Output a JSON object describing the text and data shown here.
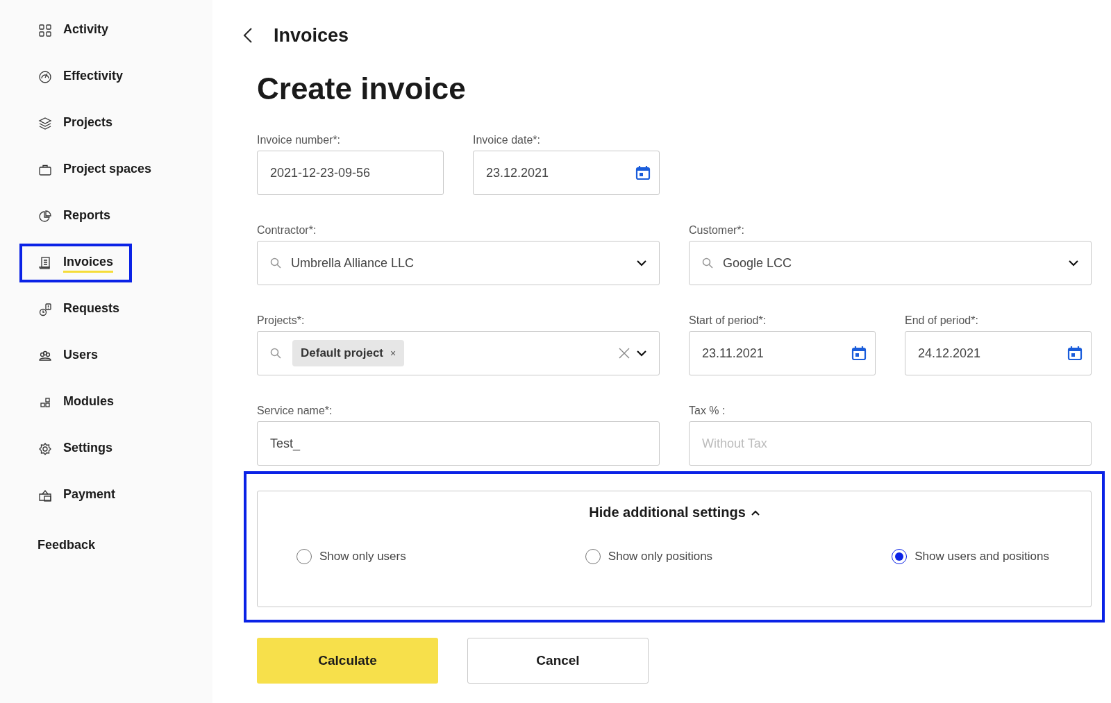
{
  "sidebar": {
    "items": [
      {
        "label": "Activity",
        "selected": false,
        "highlighted": false
      },
      {
        "label": "Effectivity",
        "selected": false,
        "highlighted": false
      },
      {
        "label": "Projects",
        "selected": false,
        "highlighted": false
      },
      {
        "label": "Project spaces",
        "selected": false,
        "highlighted": false
      },
      {
        "label": "Reports",
        "selected": false,
        "highlighted": false
      },
      {
        "label": "Invoices",
        "selected": true,
        "highlighted": true
      },
      {
        "label": "Requests",
        "selected": false,
        "highlighted": false
      },
      {
        "label": "Users",
        "selected": false,
        "highlighted": false
      },
      {
        "label": "Modules",
        "selected": false,
        "highlighted": false
      },
      {
        "label": "Settings",
        "selected": false,
        "highlighted": false
      },
      {
        "label": "Payment",
        "selected": false,
        "highlighted": false
      },
      {
        "label": "Feedback",
        "selected": false,
        "highlighted": false
      }
    ]
  },
  "header": {
    "title": "Invoices"
  },
  "page_title": "Create invoice",
  "fields": [
    {
      "kind": "text",
      "label": "Invoice number*:",
      "value": "2021-12-23-09-56"
    },
    {
      "kind": "date",
      "label": "Invoice date*:",
      "value": "23.12.2021"
    },
    {
      "kind": "select",
      "label": "Contractor*:",
      "value": "Umbrella Alliance LLC"
    },
    {
      "kind": "select",
      "label": "Customer*:",
      "value": "Google LCC"
    },
    {
      "kind": "multiselect",
      "label": "Projects*:",
      "tags": [
        "Default project"
      ],
      "tag_remove": "×"
    },
    {
      "kind": "date",
      "label": "Start of period*:",
      "value": "23.11.2021"
    },
    {
      "kind": "date",
      "label": "End of period*:",
      "value": "24.12.2021"
    },
    {
      "kind": "text",
      "label": "Service name*:",
      "value": "Test_"
    },
    {
      "kind": "text",
      "label": "Tax % :",
      "placeholder": "Without Tax"
    }
  ],
  "settings_panel": {
    "toggle": "Hide additional settings",
    "expanded": true,
    "highlighted": true,
    "options": [
      {
        "label": "Show only users",
        "selected": false
      },
      {
        "label": "Show only positions",
        "selected": false
      },
      {
        "label": "Show users and positions",
        "selected": true
      }
    ]
  },
  "buttons": [
    {
      "label": "Calculate",
      "kind": "primary"
    },
    {
      "label": "Cancel",
      "kind": "secondary"
    }
  ]
}
